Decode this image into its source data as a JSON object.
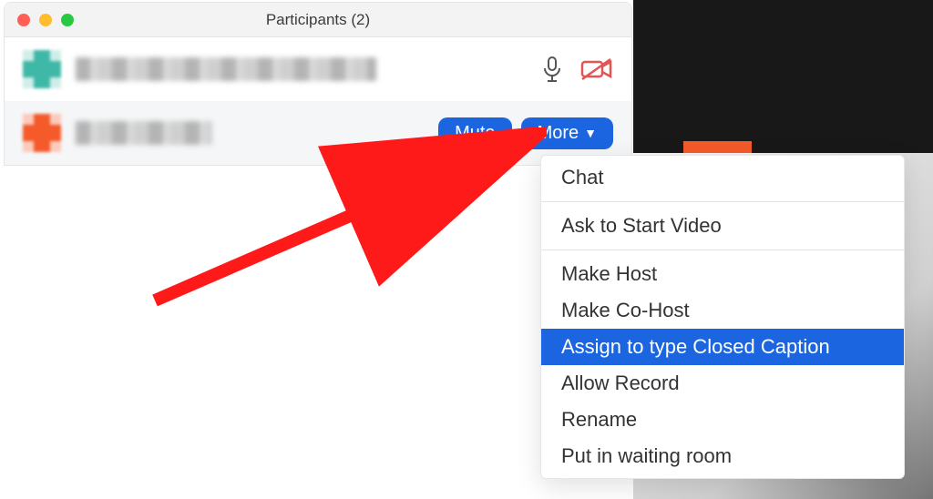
{
  "window": {
    "title": "Participants (2)"
  },
  "participants": {
    "row1": {
      "name": "[redacted]"
    },
    "row2": {
      "name": "[redacted]"
    }
  },
  "icons": {
    "mic": "microphone-icon",
    "cam": "camera-off-icon"
  },
  "buttons": {
    "mute": "Mute",
    "more": "More"
  },
  "menu": {
    "chat": "Chat",
    "ask_video": "Ask to Start Video",
    "make_host": "Make Host",
    "make_cohost": "Make Co-Host",
    "assign_cc": "Assign to type Closed Caption",
    "allow_record": "Allow Record",
    "rename": "Rename",
    "waiting_room": "Put in waiting room"
  },
  "colors": {
    "accent": "#1b66e0",
    "danger": "#e35454"
  }
}
